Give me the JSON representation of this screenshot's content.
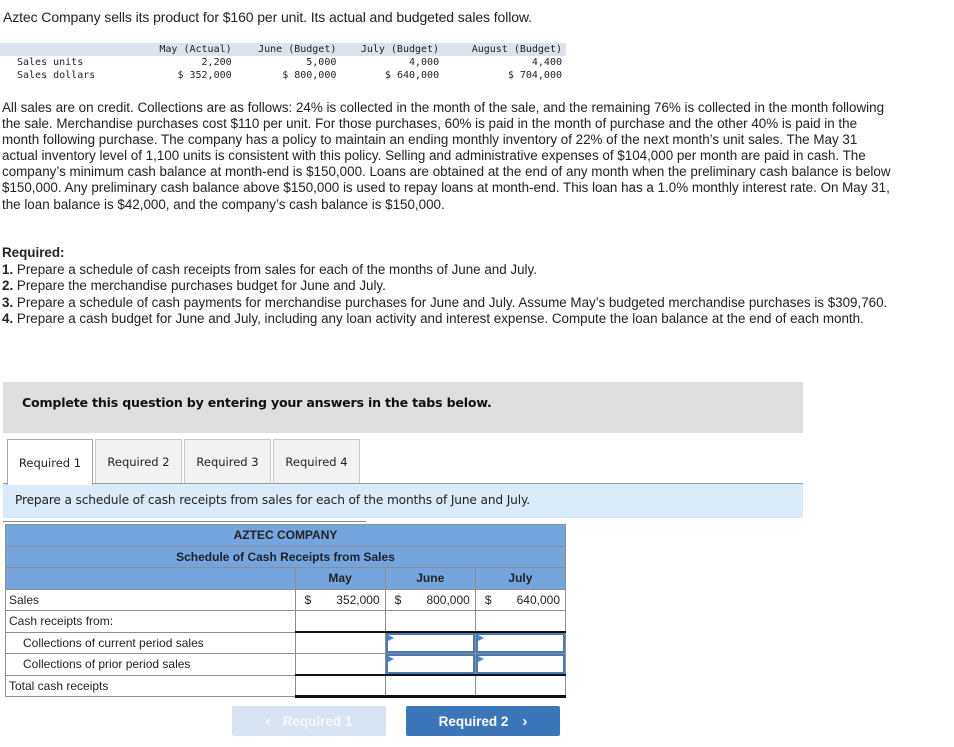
{
  "intro": "Aztec Company sells its product for $160 per unit. Its actual and budgeted sales follow.",
  "sales_table": {
    "headers": [
      "",
      "May (Actual)",
      "June (Budget)",
      "July (Budget)",
      "August (Budget)"
    ],
    "rows": [
      {
        "label": "Sales units",
        "values": [
          "2,200",
          "5,000",
          "4,000",
          "4,400"
        ]
      },
      {
        "label": "Sales dollars",
        "values": [
          "$ 352,000",
          "$ 800,000",
          "$ 640,000",
          "$ 704,000"
        ]
      }
    ]
  },
  "paragraph": "All sales are on credit. Collections are as follows: 24% is collected in the month of the sale, and the remaining 76% is collected in the month following the sale. Merchandise purchases cost $110 per unit. For those purchases, 60% is paid in the month of purchase and the other 40% is paid in the month following purchase. The company has a policy to maintain an ending monthly inventory of 22% of the next month’s unit sales. The May 31 actual inventory level of 1,100 units is consistent with this policy. Selling and administrative expenses of $104,000 per month are paid in cash. The company’s minimum cash balance at month-end is $150,000. Loans are obtained at the end of any month when the preliminary cash balance is below $150,000. Any preliminary cash balance above $150,000 is used to repay loans at month-end. This loan has a 1.0% monthly interest rate. On May 31, the loan balance is $42,000, and the company’s cash balance is $150,000.",
  "required": {
    "title": "Required:",
    "items": [
      {
        "num": "1.",
        "text": " Prepare a schedule of cash receipts from sales for each of the months of June and July."
      },
      {
        "num": "2.",
        "text": " Prepare the merchandise purchases budget for June and July."
      },
      {
        "num": "3.",
        "text": " Prepare a schedule of cash payments for merchandise purchases for June and July. Assume May’s budgeted merchandise purchases is $309,760."
      },
      {
        "num": "4.",
        "text": " Prepare a cash budget for June and July, including any loan activity and interest expense. Compute the loan balance at the end of each month."
      }
    ]
  },
  "instruction": "Complete this question by entering your answers in the tabs below.",
  "tabs": [
    {
      "label": "Required 1",
      "active": true
    },
    {
      "label": "Required 2",
      "active": false
    },
    {
      "label": "Required 3",
      "active": false
    },
    {
      "label": "Required 4",
      "active": false
    }
  ],
  "tab_description": "Prepare a schedule of cash receipts from sales for each of the months of June and July.",
  "schedule": {
    "company": "AZTEC COMPANY",
    "title": "Schedule of Cash Receipts from Sales",
    "months": [
      "May",
      "June",
      "July"
    ],
    "sales": {
      "label": "Sales",
      "currency": "$",
      "values": [
        "352,000",
        "800,000",
        "640,000"
      ]
    },
    "cash_receipts_label": "Cash receipts from:",
    "current_label": "Collections of current period sales",
    "prior_label": "Collections of prior period sales",
    "total_label": "Total cash receipts",
    "inputs": {
      "current_june": "",
      "current_july": "",
      "prior_june": "",
      "prior_july": ""
    }
  },
  "nav": {
    "prev_label": "Required 1",
    "next_label": "Required 2",
    "prev_icon": "‹",
    "next_icon": "›"
  }
}
